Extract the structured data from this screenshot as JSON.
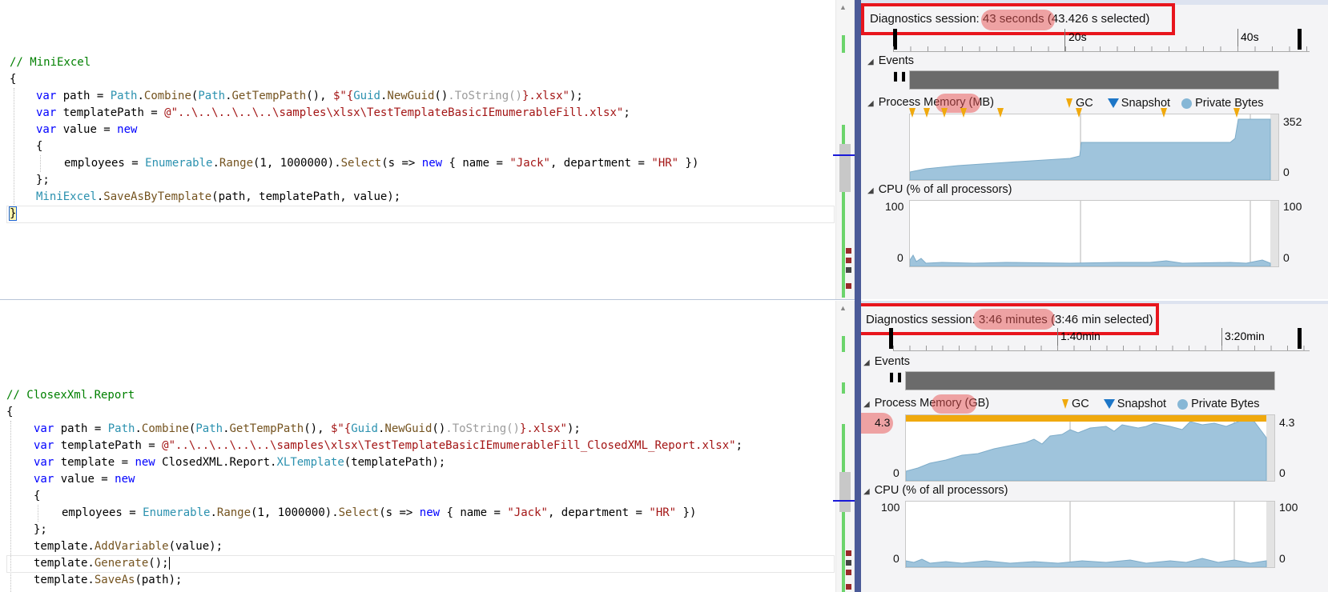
{
  "top": {
    "code": {
      "comment": "// MiniExcel",
      "open_brace": "{",
      "close_brace": "}",
      "line1": {
        "kw": "var",
        "p1": " path = ",
        "t1": "Path",
        "p2": ".",
        "f1": "Combine",
        "p3": "(",
        "t2": "Path",
        "p4": ".",
        "f2": "GetTempPath",
        "p5": "(), ",
        "s1": "$\"{",
        "t3": "Guid",
        "p6": ".",
        "f3": "NewGuid",
        "p7": "()",
        "g1": ".ToString()",
        "s2": "}.xlsx\"",
        "p8": ");"
      },
      "line2": {
        "kw": "var",
        "p1": " templatePath = ",
        "s1": "@\"..\\..\\..\\..\\..\\samples\\xlsx\\TestTemplateBasicIEmumerableFill.xlsx\"",
        "p2": ";"
      },
      "line3": {
        "kw": "var",
        "p1": " value = ",
        "kw2": "new"
      },
      "line4": "{",
      "line5": {
        "p1": "employees = ",
        "t1": "Enumerable",
        "p2": ".",
        "f1": "Range",
        "p3": "(1, 1000000).",
        "f2": "Select",
        "p4": "(s => ",
        "kw": "new",
        "p5": " { name = ",
        "s1": "\"Jack\"",
        "p6": ", department = ",
        "s2": "\"HR\"",
        "p7": " })"
      },
      "line6": "};",
      "line7": {
        "t1": "MiniExcel",
        "p1": ".",
        "f1": "SaveAsByTemplate",
        "p2": "(path, templatePath, value);"
      }
    },
    "diag": {
      "title_prefix": "Diagnostics session: ",
      "duration": "43 seconds",
      "title_suffix": " (43.426 s selected)",
      "ruler_ticks": [
        "20s",
        "40s"
      ],
      "events_label": "Events",
      "pause": "❚❚",
      "mem_label": "Process Memory ",
      "mem_unit": "(MB)",
      "mem_max": "352",
      "mem_min": "0",
      "cpu_label": "CPU (% of all processors)",
      "cpu_max": "100",
      "cpu_min": "0"
    }
  },
  "bottom": {
    "code": {
      "comment": "// ClosexXml.Report",
      "open_brace": "{",
      "line1": {
        "kw": "var",
        "p1": " path = ",
        "t1": "Path",
        "p2": ".",
        "f1": "Combine",
        "p3": "(",
        "t2": "Path",
        "p4": ".",
        "f2": "GetTempPath",
        "p5": "(), ",
        "s1": "$\"{",
        "t3": "Guid",
        "p6": ".",
        "f3": "NewGuid",
        "p7": "()",
        "g1": ".ToString()",
        "s2": "}.xlsx\"",
        "p8": ");"
      },
      "line2": {
        "kw": "var",
        "p1": " templatePath = ",
        "s1": "@\"..\\..\\..\\..\\..\\samples\\xlsx\\TestTemplateBasicIEmumerableFill_ClosedXML_Report.xlsx\"",
        "p2": ";"
      },
      "line3": {
        "kw": "var",
        "p1": " template = ",
        "kw2": "new",
        "p2": " ClosedXML.Report.",
        "t1": "XLTemplate",
        "p3": "(templatePath);"
      },
      "line4": {
        "kw": "var",
        "p1": " value = ",
        "kw2": "new"
      },
      "line5": "{",
      "line6": {
        "p1": "employees = ",
        "t1": "Enumerable",
        "p2": ".",
        "f1": "Range",
        "p3": "(1, 1000000).",
        "f2": "Select",
        "p4": "(s => ",
        "kw": "new",
        "p5": " { name = ",
        "s1": "\"Jack\"",
        "p6": ", department = ",
        "s2": "\"HR\"",
        "p7": " })"
      },
      "line7": "};",
      "line8": {
        "p1": "template.",
        "f1": "AddVariable",
        "p2": "(value);"
      },
      "line9": {
        "p1": "template.",
        "f1": "Generate",
        "p2": "();"
      },
      "line10": {
        "p1": "template.",
        "f1": "SaveAs",
        "p2": "(path);"
      }
    },
    "diag": {
      "title_prefix": "Diagnostics session: ",
      "duration": "3:46 minutes",
      "title_suffix": " (3:46 min selected)",
      "ruler_ticks": [
        "1:40min",
        "3:20min"
      ],
      "events_label": "Events",
      "pause": "❚❚",
      "mem_label": "Process Memory ",
      "mem_unit": "(GB)",
      "mem_max": "4.3",
      "mem_min": "0",
      "cpu_label": "CPU (% of all processors)",
      "cpu_max": "100",
      "cpu_min": "0"
    }
  },
  "legend": {
    "gc": "GC",
    "snapshot": "Snapshot",
    "private_bytes": "Private Bytes"
  },
  "colors": {
    "memory_fill": "#9fc4dc",
    "gc": "#f0a90d",
    "snapshot": "#1d76c7",
    "highlight_box": "#e8151d"
  }
}
